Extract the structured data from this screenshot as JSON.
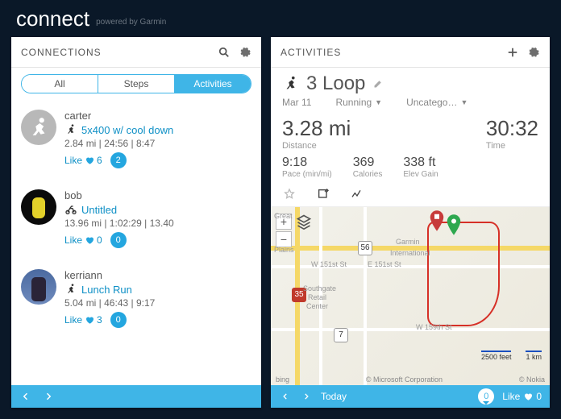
{
  "brand": {
    "name": "connect",
    "sub": "powered by Garmin"
  },
  "left": {
    "title": "CONNECTIONS",
    "tabs": {
      "all": "All",
      "steps": "Steps",
      "activities": "Activities"
    },
    "feed": [
      {
        "user": "carter",
        "activity_type": "run",
        "title": "5x400 w/ cool down",
        "stats": "2.84 mi | 24:56 | 8:47",
        "like_label": "Like",
        "likes": "6",
        "comments": "2"
      },
      {
        "user": "bob",
        "activity_type": "cycle",
        "title": "Untitled",
        "stats": "13.96 mi | 1:02:29 | 13.40",
        "like_label": "Like",
        "likes": "0",
        "comments": "0"
      },
      {
        "user": "kerriann",
        "activity_type": "run",
        "title": "Lunch Run",
        "stats": "5.04 mi | 46:43 | 9:17",
        "like_label": "Like",
        "likes": "3",
        "comments": "0"
      }
    ]
  },
  "right": {
    "header": "ACTIVITIES",
    "title": "3 Loop",
    "date": "Mar 11",
    "type_label": "Running",
    "category_label": "Uncatego…",
    "distance_value": "3.28 mi",
    "distance_label": "Distance",
    "time_value": "30:32",
    "time_label": "Time",
    "pace_value": "9:18",
    "pace_label": "Pace (min/mi)",
    "cal_value": "369",
    "cal_label": "Calories",
    "elev_value": "338 ft",
    "elev_label": "Elev Gain",
    "map": {
      "hw35": "35",
      "hw7": "7",
      "hw56": "56",
      "lbl_great": "Great",
      "lbl_plains": "Plains",
      "lbl_garmin": "Garmin",
      "lbl_intl": "International",
      "lbl_w151": "W 151st St",
      "lbl_e151": "E 151st St",
      "lbl_southgate": "Southgate",
      "lbl_retail": "Retail",
      "lbl_center": "Center",
      "lbl_w159": "W 159th St",
      "scale_ft": "2500 feet",
      "scale_km": "1 km",
      "credit_left": "bing",
      "credit_mid": "© Microsoft Corporation",
      "credit_right": "© Nokia"
    },
    "footer": {
      "today": "Today",
      "comments": "0",
      "like_label": "Like",
      "likes": "0"
    }
  }
}
